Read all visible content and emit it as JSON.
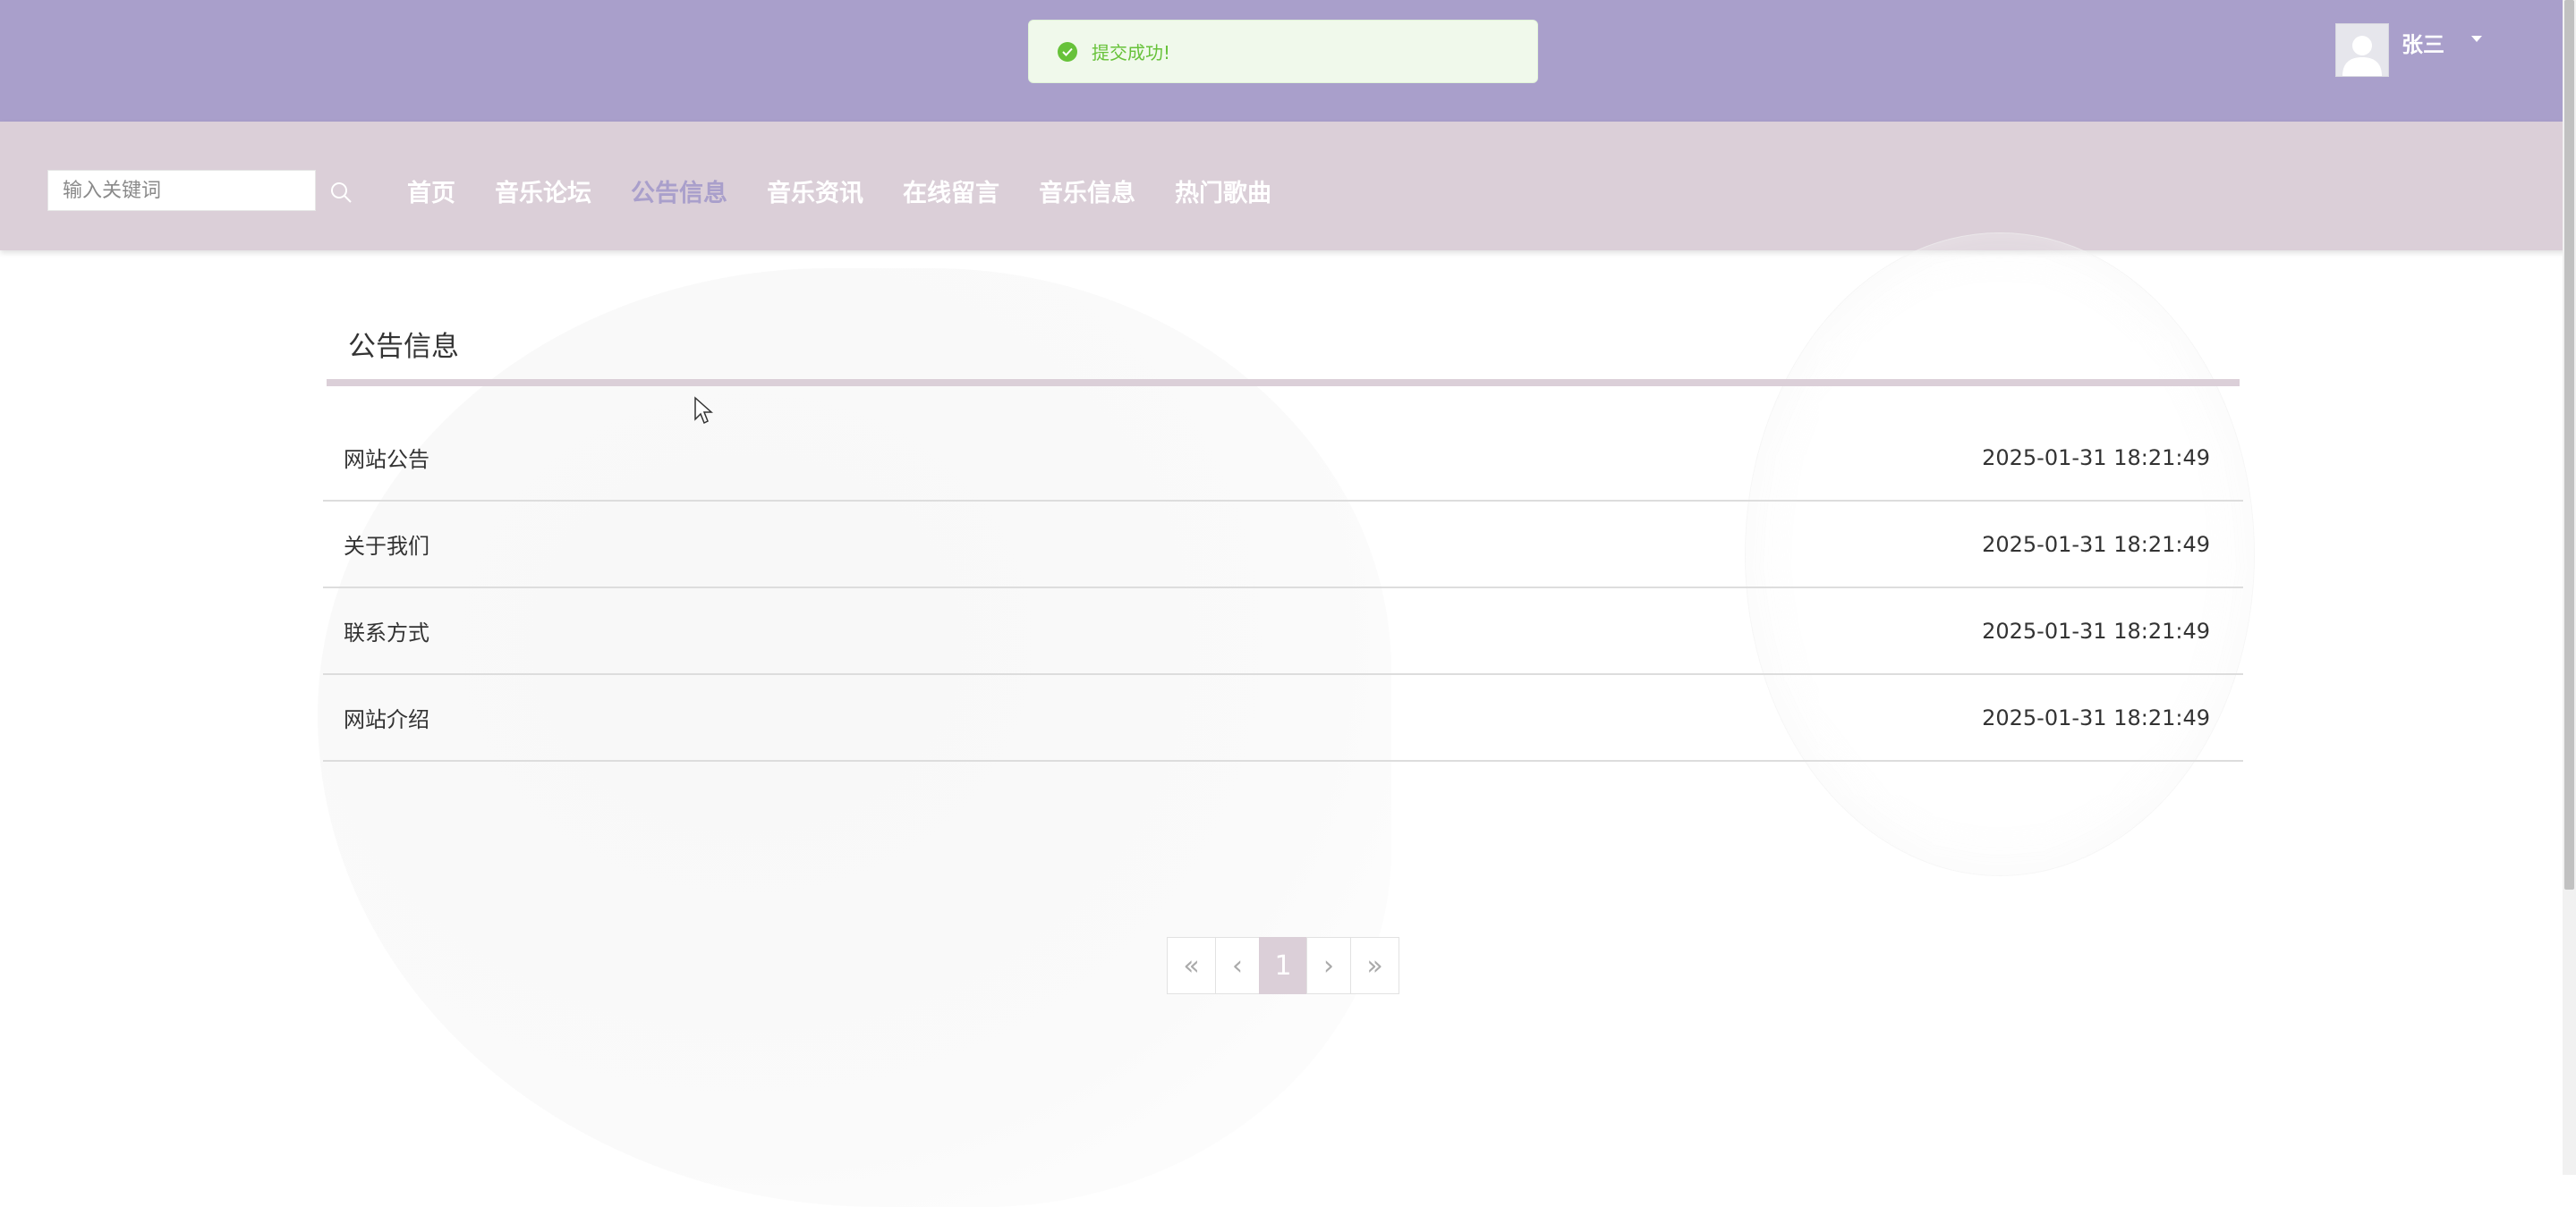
{
  "toast": {
    "message": "提交成功!",
    "icon": "check-circle-icon",
    "color": "#67c23a"
  },
  "user": {
    "name": "张三",
    "avatar_icon": "user-avatar-icon"
  },
  "search": {
    "placeholder": "输入关键词",
    "value": "",
    "icon": "search-icon"
  },
  "nav": {
    "items": [
      {
        "label": "首页",
        "active": false
      },
      {
        "label": "音乐论坛",
        "active": false
      },
      {
        "label": "公告信息",
        "active": true
      },
      {
        "label": "音乐资讯",
        "active": false
      },
      {
        "label": "在线留言",
        "active": false
      },
      {
        "label": "音乐信息",
        "active": false
      },
      {
        "label": "热门歌曲",
        "active": false
      }
    ]
  },
  "main": {
    "section_title": "公告信息",
    "notices": [
      {
        "title": "网站公告",
        "date": "2025-01-31 18:21:49"
      },
      {
        "title": "关于我们",
        "date": "2025-01-31 18:21:49"
      },
      {
        "title": "联系方式",
        "date": "2025-01-31 18:21:49"
      },
      {
        "title": "网站介绍",
        "date": "2025-01-31 18:21:49"
      }
    ]
  },
  "pagination": {
    "first": "«",
    "prev": "‹",
    "current": "1",
    "next": "›",
    "last": "»"
  },
  "colors": {
    "header_bg": "#a99fcb",
    "nav_bg": "#dbcfd8",
    "active_nav": "#a99fcb",
    "success": "#67c23a"
  }
}
